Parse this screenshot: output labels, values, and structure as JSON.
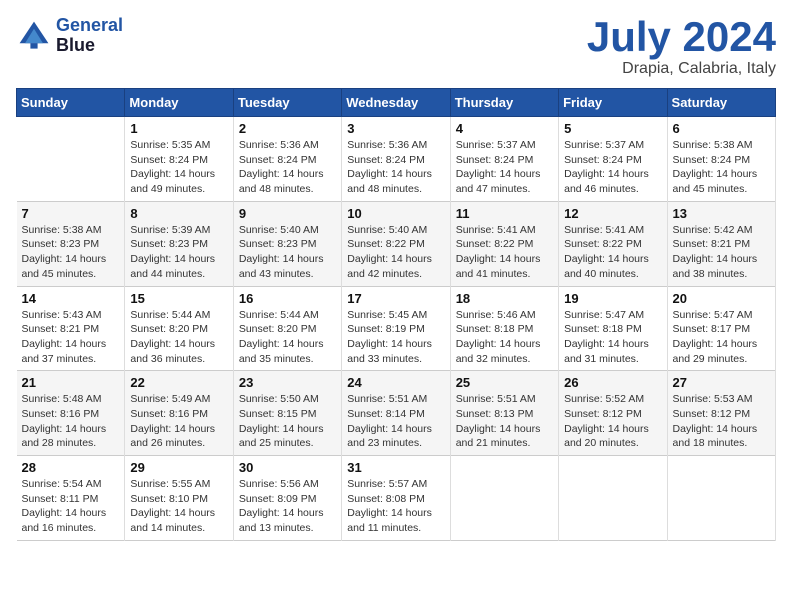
{
  "header": {
    "logo_line1": "General",
    "logo_line2": "Blue",
    "main_title": "July 2024",
    "subtitle": "Drapia, Calabria, Italy"
  },
  "calendar": {
    "days_of_week": [
      "Sunday",
      "Monday",
      "Tuesday",
      "Wednesday",
      "Thursday",
      "Friday",
      "Saturday"
    ],
    "weeks": [
      [
        {
          "day": "",
          "detail": ""
        },
        {
          "day": "1",
          "detail": "Sunrise: 5:35 AM\nSunset: 8:24 PM\nDaylight: 14 hours\nand 49 minutes."
        },
        {
          "day": "2",
          "detail": "Sunrise: 5:36 AM\nSunset: 8:24 PM\nDaylight: 14 hours\nand 48 minutes."
        },
        {
          "day": "3",
          "detail": "Sunrise: 5:36 AM\nSunset: 8:24 PM\nDaylight: 14 hours\nand 48 minutes."
        },
        {
          "day": "4",
          "detail": "Sunrise: 5:37 AM\nSunset: 8:24 PM\nDaylight: 14 hours\nand 47 minutes."
        },
        {
          "day": "5",
          "detail": "Sunrise: 5:37 AM\nSunset: 8:24 PM\nDaylight: 14 hours\nand 46 minutes."
        },
        {
          "day": "6",
          "detail": "Sunrise: 5:38 AM\nSunset: 8:24 PM\nDaylight: 14 hours\nand 45 minutes."
        }
      ],
      [
        {
          "day": "7",
          "detail": "Sunrise: 5:38 AM\nSunset: 8:23 PM\nDaylight: 14 hours\nand 45 minutes."
        },
        {
          "day": "8",
          "detail": "Sunrise: 5:39 AM\nSunset: 8:23 PM\nDaylight: 14 hours\nand 44 minutes."
        },
        {
          "day": "9",
          "detail": "Sunrise: 5:40 AM\nSunset: 8:23 PM\nDaylight: 14 hours\nand 43 minutes."
        },
        {
          "day": "10",
          "detail": "Sunrise: 5:40 AM\nSunset: 8:22 PM\nDaylight: 14 hours\nand 42 minutes."
        },
        {
          "day": "11",
          "detail": "Sunrise: 5:41 AM\nSunset: 8:22 PM\nDaylight: 14 hours\nand 41 minutes."
        },
        {
          "day": "12",
          "detail": "Sunrise: 5:41 AM\nSunset: 8:22 PM\nDaylight: 14 hours\nand 40 minutes."
        },
        {
          "day": "13",
          "detail": "Sunrise: 5:42 AM\nSunset: 8:21 PM\nDaylight: 14 hours\nand 38 minutes."
        }
      ],
      [
        {
          "day": "14",
          "detail": "Sunrise: 5:43 AM\nSunset: 8:21 PM\nDaylight: 14 hours\nand 37 minutes."
        },
        {
          "day": "15",
          "detail": "Sunrise: 5:44 AM\nSunset: 8:20 PM\nDaylight: 14 hours\nand 36 minutes."
        },
        {
          "day": "16",
          "detail": "Sunrise: 5:44 AM\nSunset: 8:20 PM\nDaylight: 14 hours\nand 35 minutes."
        },
        {
          "day": "17",
          "detail": "Sunrise: 5:45 AM\nSunset: 8:19 PM\nDaylight: 14 hours\nand 33 minutes."
        },
        {
          "day": "18",
          "detail": "Sunrise: 5:46 AM\nSunset: 8:18 PM\nDaylight: 14 hours\nand 32 minutes."
        },
        {
          "day": "19",
          "detail": "Sunrise: 5:47 AM\nSunset: 8:18 PM\nDaylight: 14 hours\nand 31 minutes."
        },
        {
          "day": "20",
          "detail": "Sunrise: 5:47 AM\nSunset: 8:17 PM\nDaylight: 14 hours\nand 29 minutes."
        }
      ],
      [
        {
          "day": "21",
          "detail": "Sunrise: 5:48 AM\nSunset: 8:16 PM\nDaylight: 14 hours\nand 28 minutes."
        },
        {
          "day": "22",
          "detail": "Sunrise: 5:49 AM\nSunset: 8:16 PM\nDaylight: 14 hours\nand 26 minutes."
        },
        {
          "day": "23",
          "detail": "Sunrise: 5:50 AM\nSunset: 8:15 PM\nDaylight: 14 hours\nand 25 minutes."
        },
        {
          "day": "24",
          "detail": "Sunrise: 5:51 AM\nSunset: 8:14 PM\nDaylight: 14 hours\nand 23 minutes."
        },
        {
          "day": "25",
          "detail": "Sunrise: 5:51 AM\nSunset: 8:13 PM\nDaylight: 14 hours\nand 21 minutes."
        },
        {
          "day": "26",
          "detail": "Sunrise: 5:52 AM\nSunset: 8:12 PM\nDaylight: 14 hours\nand 20 minutes."
        },
        {
          "day": "27",
          "detail": "Sunrise: 5:53 AM\nSunset: 8:12 PM\nDaylight: 14 hours\nand 18 minutes."
        }
      ],
      [
        {
          "day": "28",
          "detail": "Sunrise: 5:54 AM\nSunset: 8:11 PM\nDaylight: 14 hours\nand 16 minutes."
        },
        {
          "day": "29",
          "detail": "Sunrise: 5:55 AM\nSunset: 8:10 PM\nDaylight: 14 hours\nand 14 minutes."
        },
        {
          "day": "30",
          "detail": "Sunrise: 5:56 AM\nSunset: 8:09 PM\nDaylight: 14 hours\nand 13 minutes."
        },
        {
          "day": "31",
          "detail": "Sunrise: 5:57 AM\nSunset: 8:08 PM\nDaylight: 14 hours\nand 11 minutes."
        },
        {
          "day": "",
          "detail": ""
        },
        {
          "day": "",
          "detail": ""
        },
        {
          "day": "",
          "detail": ""
        }
      ]
    ]
  }
}
